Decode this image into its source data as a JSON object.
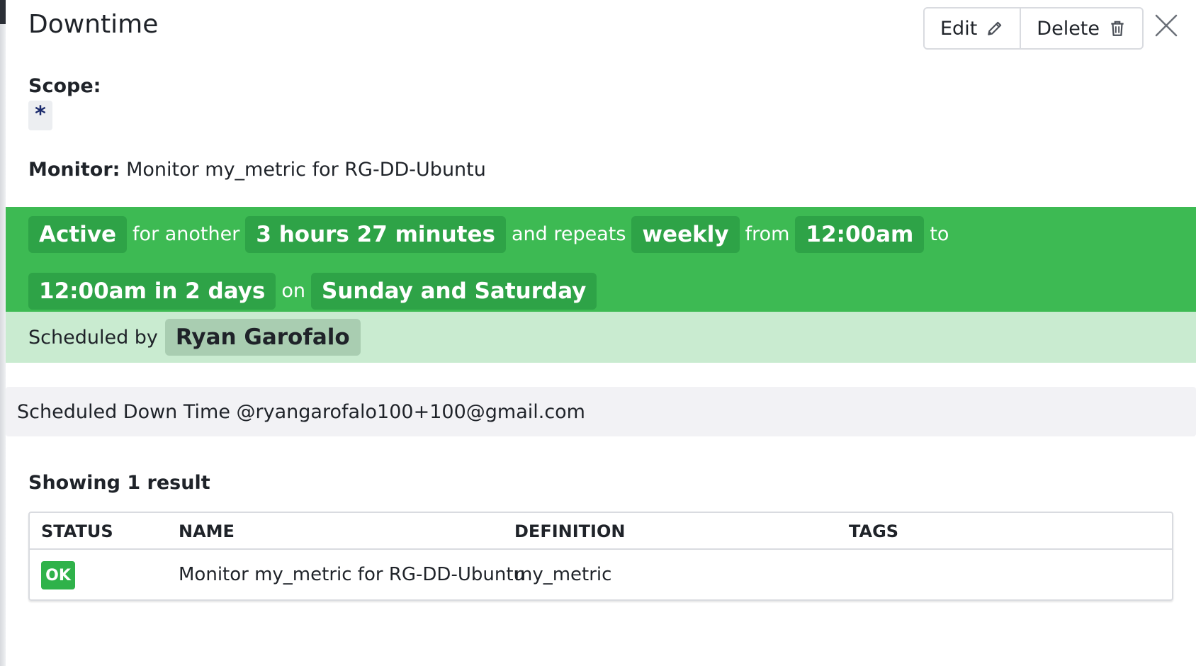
{
  "header": {
    "title": "Downtime"
  },
  "actions": {
    "edit_label": "Edit",
    "delete_label": "Delete"
  },
  "scope": {
    "label": "Scope:",
    "value": "*"
  },
  "monitor": {
    "label": "Monitor:",
    "value": "Monitor my_metric for RG-DD-Ubuntu"
  },
  "schedule": {
    "status": "Active",
    "for_another_text": "for another",
    "remaining": "3 hours 27 minutes",
    "repeats_text": "and repeats",
    "frequency": "weekly",
    "from_text": "from",
    "start_time": "12:00am",
    "to_text": "to",
    "end_time": "12:00am in 2 days",
    "on_text": "on",
    "days": "Sunday and Saturday"
  },
  "scheduled_by": {
    "label": "Scheduled by",
    "name": "Ryan Garofalo"
  },
  "message": "Scheduled Down Time @ryangarofalo100+100@gmail.com",
  "results": {
    "summary": "Showing 1 result",
    "columns": [
      "STATUS",
      "NAME",
      "DEFINITION",
      "TAGS"
    ],
    "rows": [
      {
        "status": "OK",
        "name": "Monitor my_metric for RG-DD-Ubuntu",
        "definition": "my_metric",
        "tags": ""
      }
    ]
  },
  "colors": {
    "active_band": "#3dba53",
    "active_chip": "#2ea347",
    "scheduled_band": "#c9ebd0",
    "ok_badge": "#2fb24a"
  },
  "icons": {
    "edit": "pencil-icon",
    "delete": "trash-icon",
    "close": "close-icon"
  }
}
